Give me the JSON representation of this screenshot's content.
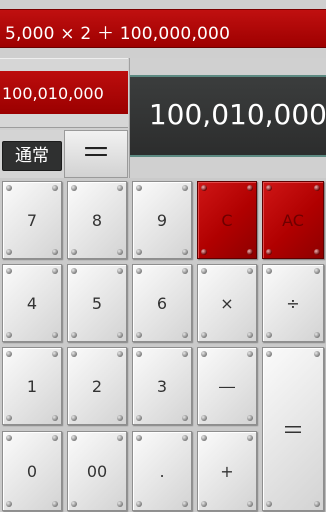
{
  "formula": {
    "expression": "5,000 × 2 ＋ 100,000,000"
  },
  "memory": {
    "value": "100,010,000"
  },
  "display": {
    "result": "100,010,000"
  },
  "mode": {
    "label": "通常"
  },
  "equals_top": {
    "label": "＝"
  },
  "keys": {
    "seven": "7",
    "eight": "8",
    "nine": "9",
    "clear": "C",
    "all_clear": "AC",
    "four": "4",
    "five": "5",
    "six": "6",
    "multiply": "×",
    "divide": "÷",
    "one": "1",
    "two": "2",
    "three": "3",
    "minus": "―",
    "equals": "＝",
    "zero": "0",
    "double_zero": "00",
    "decimal": ".",
    "plus": "+"
  },
  "colors": {
    "accent_red": "#b00000",
    "display_dark": "#333535",
    "panel_gray": "#cfcfcf",
    "key_light": "#e9e9e9"
  }
}
